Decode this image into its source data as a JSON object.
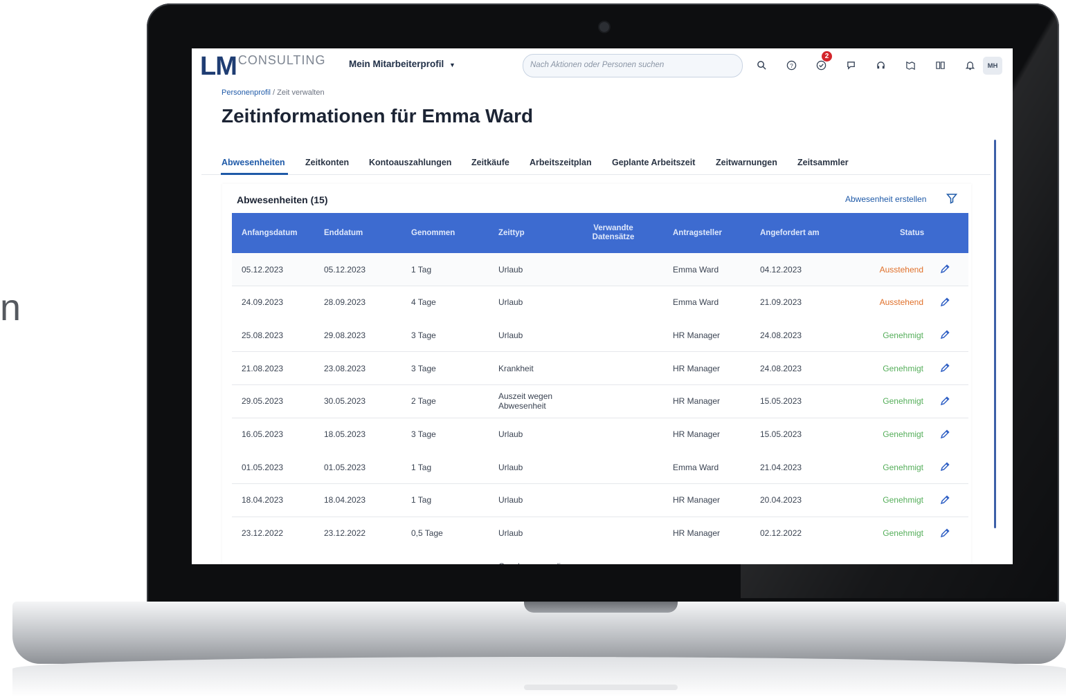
{
  "edge_glyph": "n",
  "header": {
    "logo_lm": "LM",
    "logo_consulting": "CONSULTING",
    "profile_menu": "Mein Mitarbeiterprofil",
    "search_placeholder": "Nach Aktionen oder Personen suchen",
    "notification_count": "2",
    "avatar_initials": "MH"
  },
  "breadcrumb": {
    "link": "Personenprofil",
    "separator": " / ",
    "current": "Zeit verwalten"
  },
  "page_title": "Zeitinformationen für Emma Ward",
  "tabs": [
    "Abwesenheiten",
    "Zeitkonten",
    "Kontoauszahlungen",
    "Zeitkäufe",
    "Arbeitszeitplan",
    "Geplante Arbeitszeit",
    "Zeitwarnungen",
    "Zeitsammler"
  ],
  "panel": {
    "title": "Abwesenheiten (15)",
    "create_label": "Abwesenheit erstellen"
  },
  "table": {
    "headers": [
      "Anfangsdatum",
      "Enddatum",
      "Genommen",
      "Zeittyp",
      "Verwandte Datensätze",
      "Antragsteller",
      "Angefordert am",
      "Status"
    ],
    "rows": [
      {
        "start": "05.12.2023",
        "end": "05.12.2023",
        "taken": "1 Tag",
        "type": "Urlaub",
        "requester": "Emma Ward",
        "requested": "04.12.2023",
        "status": "Ausstehend"
      },
      {
        "start": "24.09.2023",
        "end": "28.09.2023",
        "taken": "4 Tage",
        "type": "Urlaub",
        "requester": "Emma Ward",
        "requested": "21.09.2023",
        "status": "Ausstehend"
      },
      {
        "start": "25.08.2023",
        "end": "29.08.2023",
        "taken": "3 Tage",
        "type": "Urlaub",
        "requester": "HR Manager",
        "requested": "24.08.2023",
        "status": "Genehmigt"
      },
      {
        "start": "21.08.2023",
        "end": "23.08.2023",
        "taken": "3 Tage",
        "type": "Krankheit",
        "requester": "HR Manager",
        "requested": "24.08.2023",
        "status": "Genehmigt"
      },
      {
        "start": "29.05.2023",
        "end": "30.05.2023",
        "taken": "2 Tage",
        "type": "Auszeit wegen Abwesenheit",
        "requester": "HR Manager",
        "requested": "15.05.2023",
        "status": "Genehmigt"
      },
      {
        "start": "16.05.2023",
        "end": "18.05.2023",
        "taken": "3 Tage",
        "type": "Urlaub",
        "requester": "HR Manager",
        "requested": "15.05.2023",
        "status": "Genehmigt"
      },
      {
        "start": "01.05.2023",
        "end": "01.05.2023",
        "taken": "1 Tag",
        "type": "Urlaub",
        "requester": "Emma Ward",
        "requested": "21.04.2023",
        "status": "Genehmigt"
      },
      {
        "start": "18.04.2023",
        "end": "18.04.2023",
        "taken": "1 Tag",
        "type": "Urlaub",
        "requester": "HR Manager",
        "requested": "20.04.2023",
        "status": "Genehmigt"
      },
      {
        "start": "23.12.2022",
        "end": "23.12.2022",
        "taken": "0,5 Tage",
        "type": "Urlaub",
        "requester": "HR Manager",
        "requested": "02.12.2022",
        "status": "Genehmigt"
      },
      {
        "start": "",
        "end": "",
        "taken": "",
        "type": "Geschworenendien",
        "requester": "",
        "requested": "",
        "status": ""
      }
    ]
  },
  "colors": {
    "brand": "#1f3d73",
    "link": "#1f5aa8",
    "table_header": "#3d6bd0",
    "status_pending": "#e0702a",
    "status_approved": "#55ae5a"
  }
}
